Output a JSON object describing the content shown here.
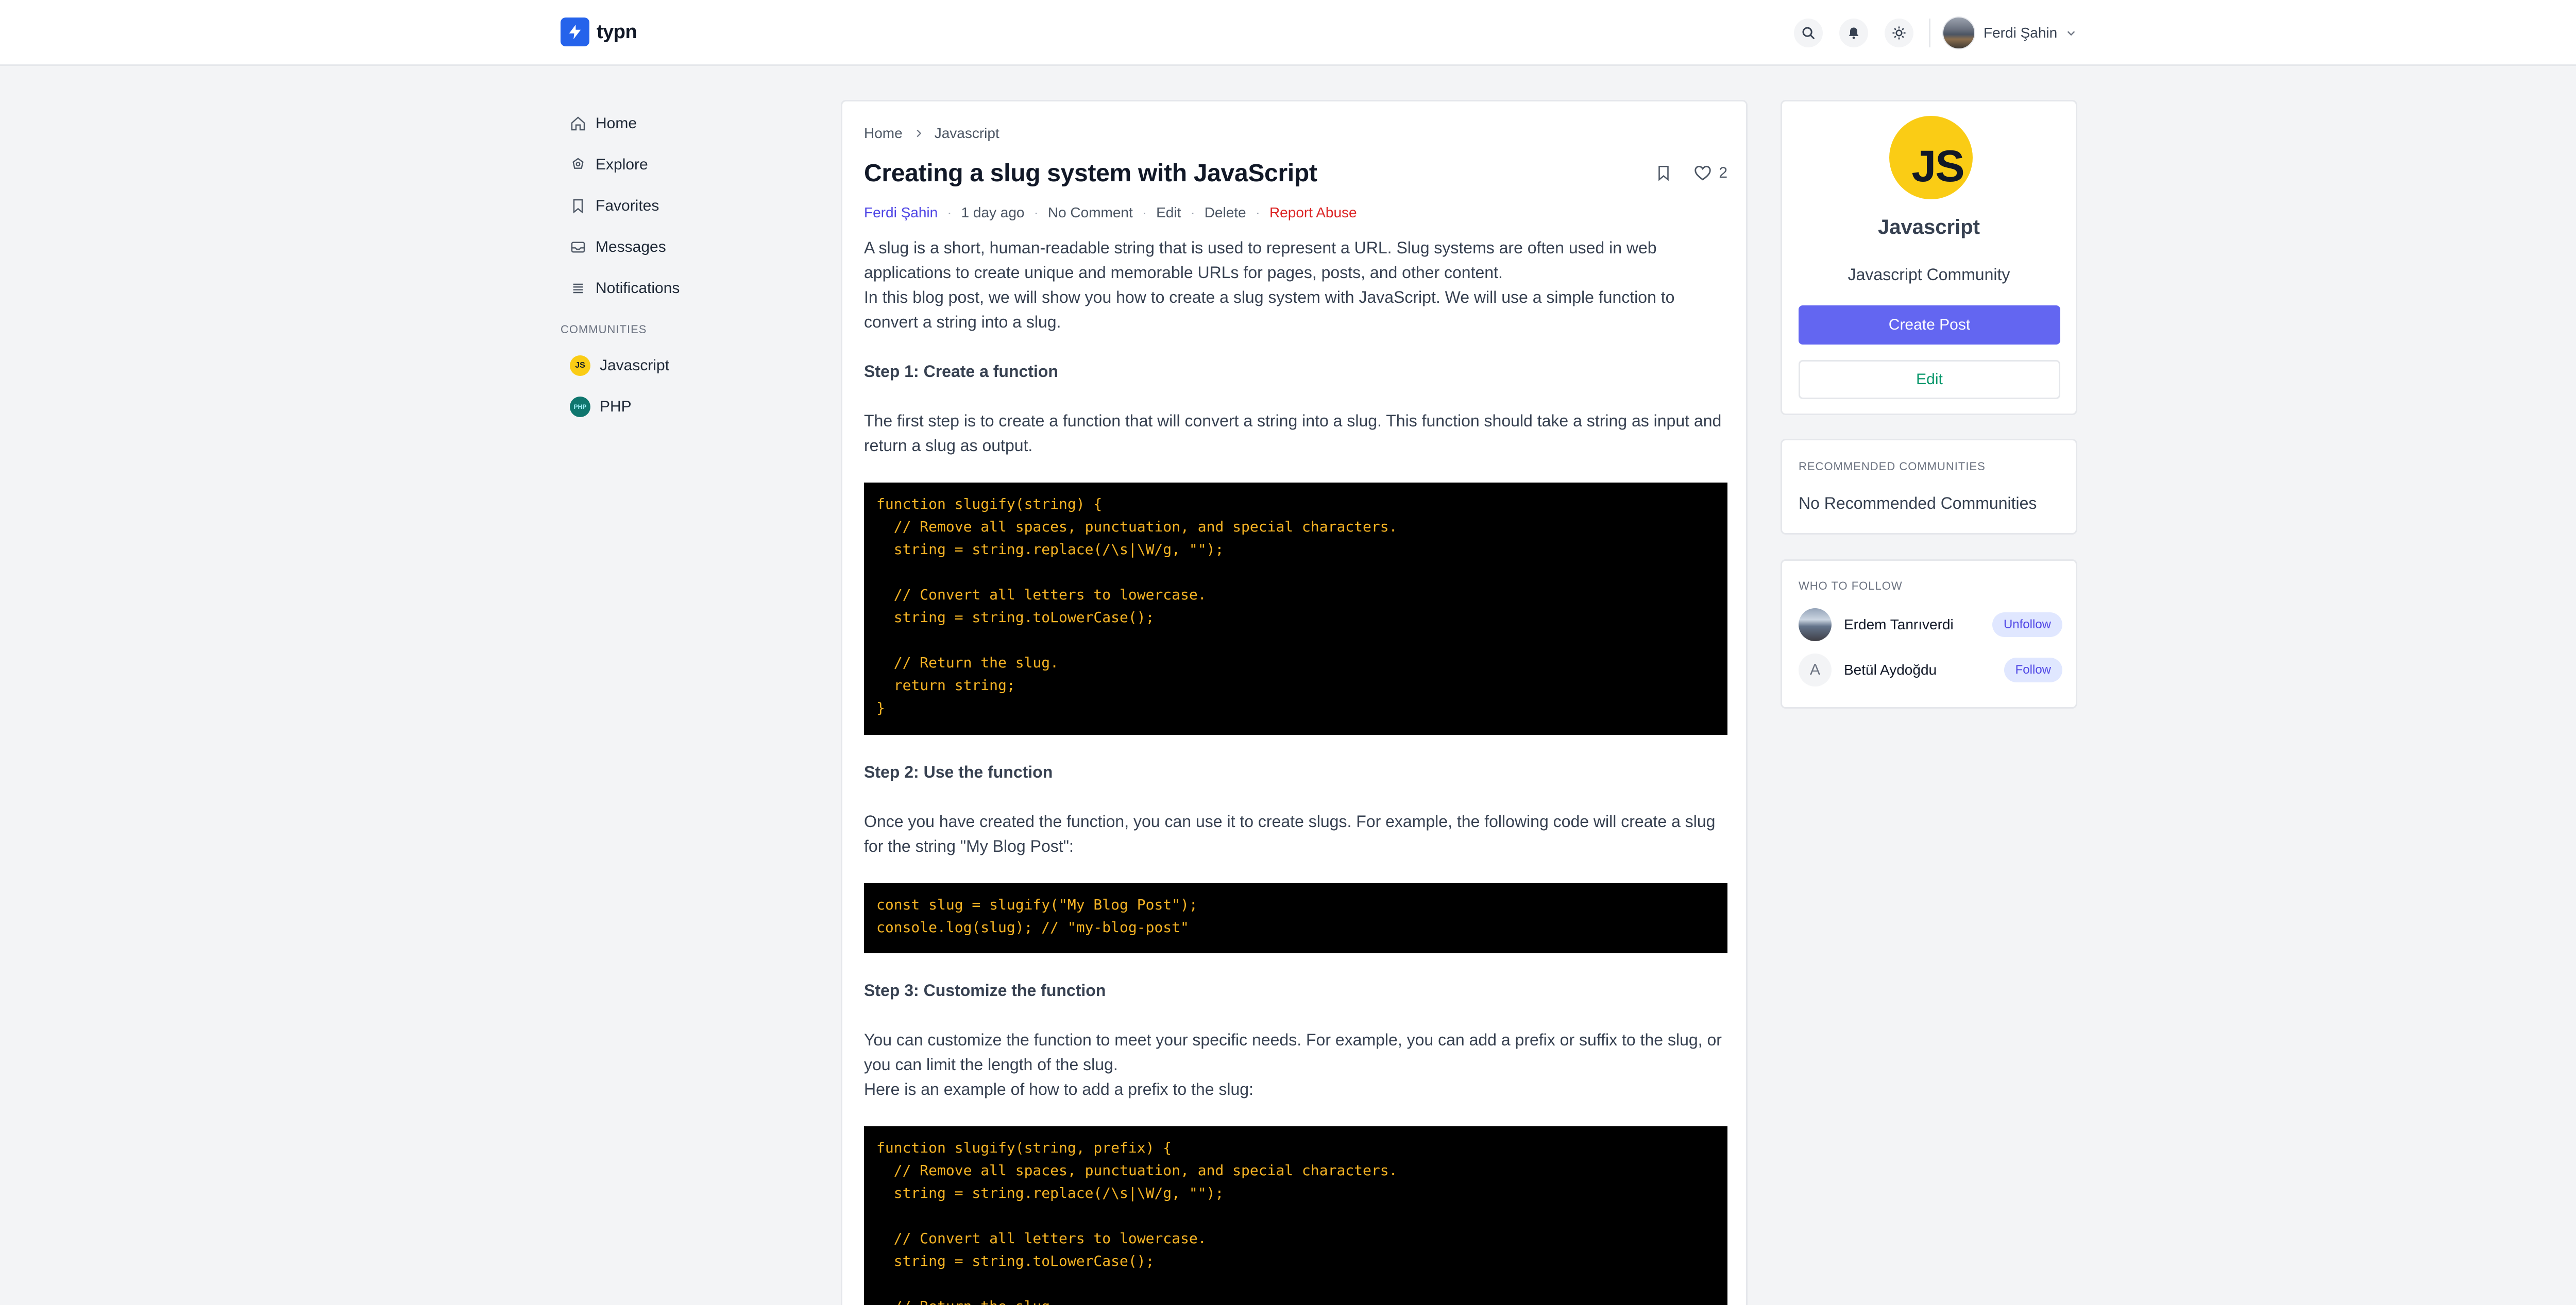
{
  "brand": {
    "name": "typn",
    "accent": "#2563eb"
  },
  "header": {
    "search_icon": "search-icon",
    "bell_icon": "bell-icon",
    "theme_icon": "sun-icon",
    "user_name": "Ferdi Şahin"
  },
  "sidebar": {
    "items": [
      {
        "label": "Home",
        "icon": "home-icon"
      },
      {
        "label": "Explore",
        "icon": "compass-icon"
      },
      {
        "label": "Favorites",
        "icon": "bookmark-icon"
      },
      {
        "label": "Messages",
        "icon": "inbox-icon"
      },
      {
        "label": "Notifications",
        "icon": "list-icon"
      }
    ],
    "communities_label": "COMMUNITIES",
    "communities": [
      {
        "label": "Javascript",
        "badge": "JS"
      },
      {
        "label": "PHP",
        "badge": "PHP"
      }
    ]
  },
  "article": {
    "breadcrumb": [
      "Home",
      "Javascript"
    ],
    "title": "Creating a slug system with JavaScript",
    "likes": "2",
    "meta": {
      "author": "Ferdi Şahin",
      "time": "1 day ago",
      "comments": "No Comment",
      "edit": "Edit",
      "delete": "Delete",
      "report": "Report Abuse"
    },
    "intro_1": "A slug is a short, human-readable string that is used to represent a URL. Slug systems are often used in web applications to create unique and memorable URLs for pages, posts, and other content.",
    "intro_2": "In this blog post, we will show you how to create a slug system with JavaScript. We will use a simple function to convert a string into a slug.",
    "step1_title": "Step 1: Create a function",
    "step1_text": "The first step is to create a function that will convert a string into a slug. This function should take a string as input and return a slug as output.",
    "code1": "function slugify(string) {\n  // Remove all spaces, punctuation, and special characters.\n  string = string.replace(/\\s|\\W/g, \"\");\n\n  // Convert all letters to lowercase.\n  string = string.toLowerCase();\n\n  // Return the slug.\n  return string;\n}",
    "step2_title": "Step 2: Use the function",
    "step2_text": "Once you have created the function, you can use it to create slugs. For example, the following code will create a slug for the string \"My Blog Post\":",
    "code2": "const slug = slugify(\"My Blog Post\");\nconsole.log(slug); // \"my-blog-post\"",
    "step3_title": "Step 3: Customize the function",
    "step3_text_1": "You can customize the function to meet your specific needs. For example, you can add a prefix or suffix to the slug, or you can limit the length of the slug.",
    "step3_text_2": "Here is an example of how to add a prefix to the slug:",
    "code3": "function slugify(string, prefix) {\n  // Remove all spaces, punctuation, and special characters.\n  string = string.replace(/\\s|\\W/g, \"\");\n\n  // Convert all letters to lowercase.\n  string = string.toLowerCase();\n\n  // Return the slug."
  },
  "community": {
    "logo_text": "JS",
    "name": "Javascript",
    "description": "Javascript Community",
    "create_label": "Create Post",
    "edit_label": "Edit"
  },
  "recommended": {
    "label": "RECOMMENDED COMMUNITIES",
    "empty": "No Recommended Communities"
  },
  "who_to_follow": {
    "label": "WHO TO FOLLOW",
    "users": [
      {
        "name": "Erdem Tanrıverdi",
        "action": "Unfollow"
      },
      {
        "name": "Betül Aydoğdu",
        "initial": "A",
        "action": "Follow"
      }
    ]
  }
}
